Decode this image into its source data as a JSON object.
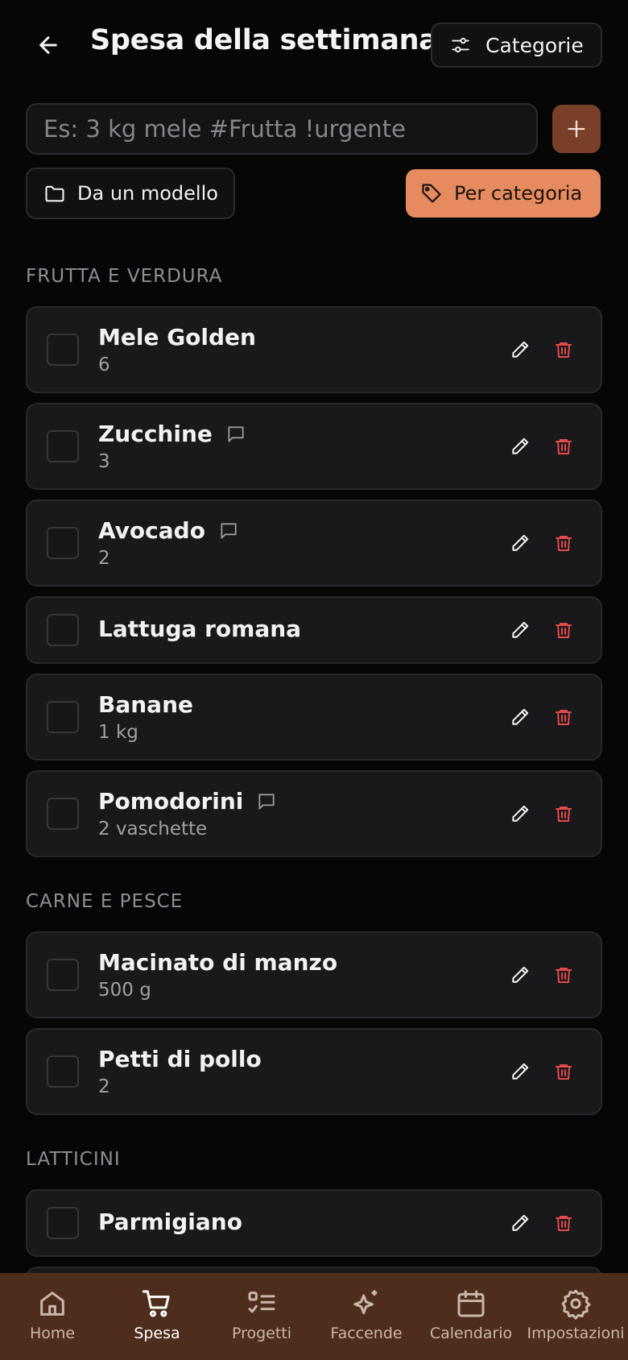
{
  "header": {
    "title": "Spesa della settimana",
    "categories_label": "Categorie"
  },
  "add_item": {
    "placeholder": "Es: 3 kg mele #Frutta !urgente",
    "value": ""
  },
  "actions": {
    "template_label": "Da un modello",
    "by_category_label": "Per categoria"
  },
  "sections": [
    {
      "title": "FRUTTA E VERDURA",
      "items": [
        {
          "name": "Mele Golden",
          "qty": "6",
          "note": false,
          "checked": false
        },
        {
          "name": "Zucchine",
          "qty": "3",
          "note": true,
          "checked": false
        },
        {
          "name": "Avocado",
          "qty": "2",
          "note": true,
          "checked": false
        },
        {
          "name": "Lattuga romana",
          "qty": "",
          "note": false,
          "checked": false
        },
        {
          "name": "Banane",
          "qty": "1 kg",
          "note": false,
          "checked": false
        },
        {
          "name": "Pomodorini",
          "qty": "2 vaschette",
          "note": true,
          "checked": false
        }
      ]
    },
    {
      "title": "CARNE E PESCE",
      "items": [
        {
          "name": "Macinato di manzo",
          "qty": "500 g",
          "note": false,
          "checked": false
        },
        {
          "name": "Petti di pollo",
          "qty": "2",
          "note": false,
          "checked": false
        }
      ]
    },
    {
      "title": "LATTICINI",
      "items": [
        {
          "name": "Parmigiano",
          "qty": "",
          "note": false,
          "checked": false
        }
      ]
    }
  ],
  "nav": [
    {
      "label": "Home",
      "icon": "home-icon",
      "active": false
    },
    {
      "label": "Spesa",
      "icon": "cart-icon",
      "active": true
    },
    {
      "label": "Progetti",
      "icon": "checklist-icon",
      "active": false
    },
    {
      "label": "Faccende",
      "icon": "sparkles-icon",
      "active": false
    },
    {
      "label": "Calendario",
      "icon": "calendar-icon",
      "active": false
    },
    {
      "label": "Impostazioni",
      "icon": "gear-icon",
      "active": false
    }
  ],
  "colors": {
    "accent": "#e58b5f",
    "add_button": "#7a3f28",
    "nav_bg": "#4f2d1c",
    "delete": "#e5484d"
  }
}
